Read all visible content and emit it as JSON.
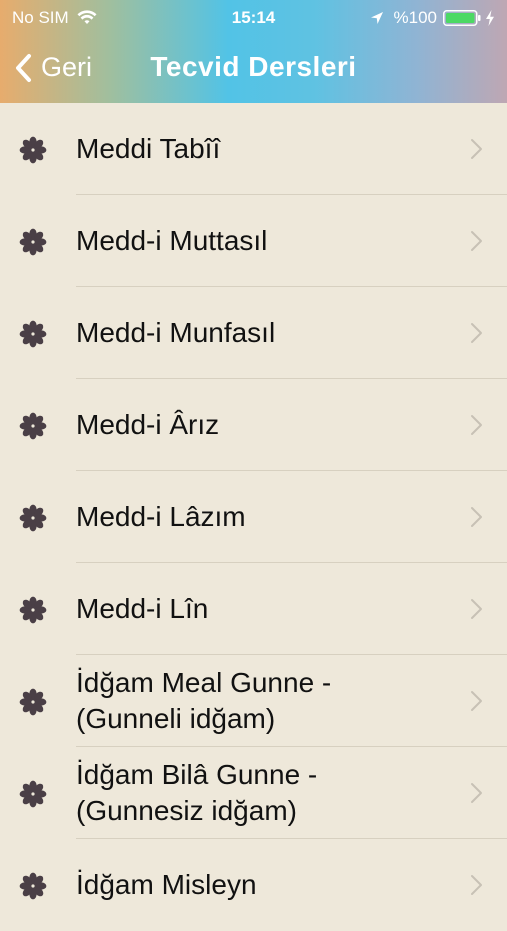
{
  "status_bar": {
    "carrier": "No SIM",
    "time": "15:14",
    "battery": "%100"
  },
  "nav": {
    "back_label": "Geri",
    "title": "Tecvid Dersleri"
  },
  "colors": {
    "background": "#eee8da",
    "icon": "#4a3f46",
    "chevron": "#c7c1b5"
  },
  "items": [
    {
      "lines": [
        "Meddi Tabîî"
      ],
      "icon": "flower-icon"
    },
    {
      "lines": [
        "Medd-i Muttasıl"
      ],
      "icon": "flower-icon"
    },
    {
      "lines": [
        "Medd-i Munfasıl"
      ],
      "icon": "flower-icon"
    },
    {
      "lines": [
        "Medd-i Ârız"
      ],
      "icon": "flower-icon"
    },
    {
      "lines": [
        "Medd-i Lâzım"
      ],
      "icon": "flower-icon"
    },
    {
      "lines": [
        "Medd-i Lîn"
      ],
      "icon": "flower-icon"
    },
    {
      "lines": [
        "İdğam Meal Gunne -",
        "(Gunneli idğam)"
      ],
      "icon": "flower-icon"
    },
    {
      "lines": [
        "İdğam Bilâ Gunne -",
        "(Gunnesiz idğam)"
      ],
      "icon": "flower-icon"
    },
    {
      "lines": [
        "İdğam Misleyn"
      ],
      "icon": "flower-icon"
    }
  ]
}
